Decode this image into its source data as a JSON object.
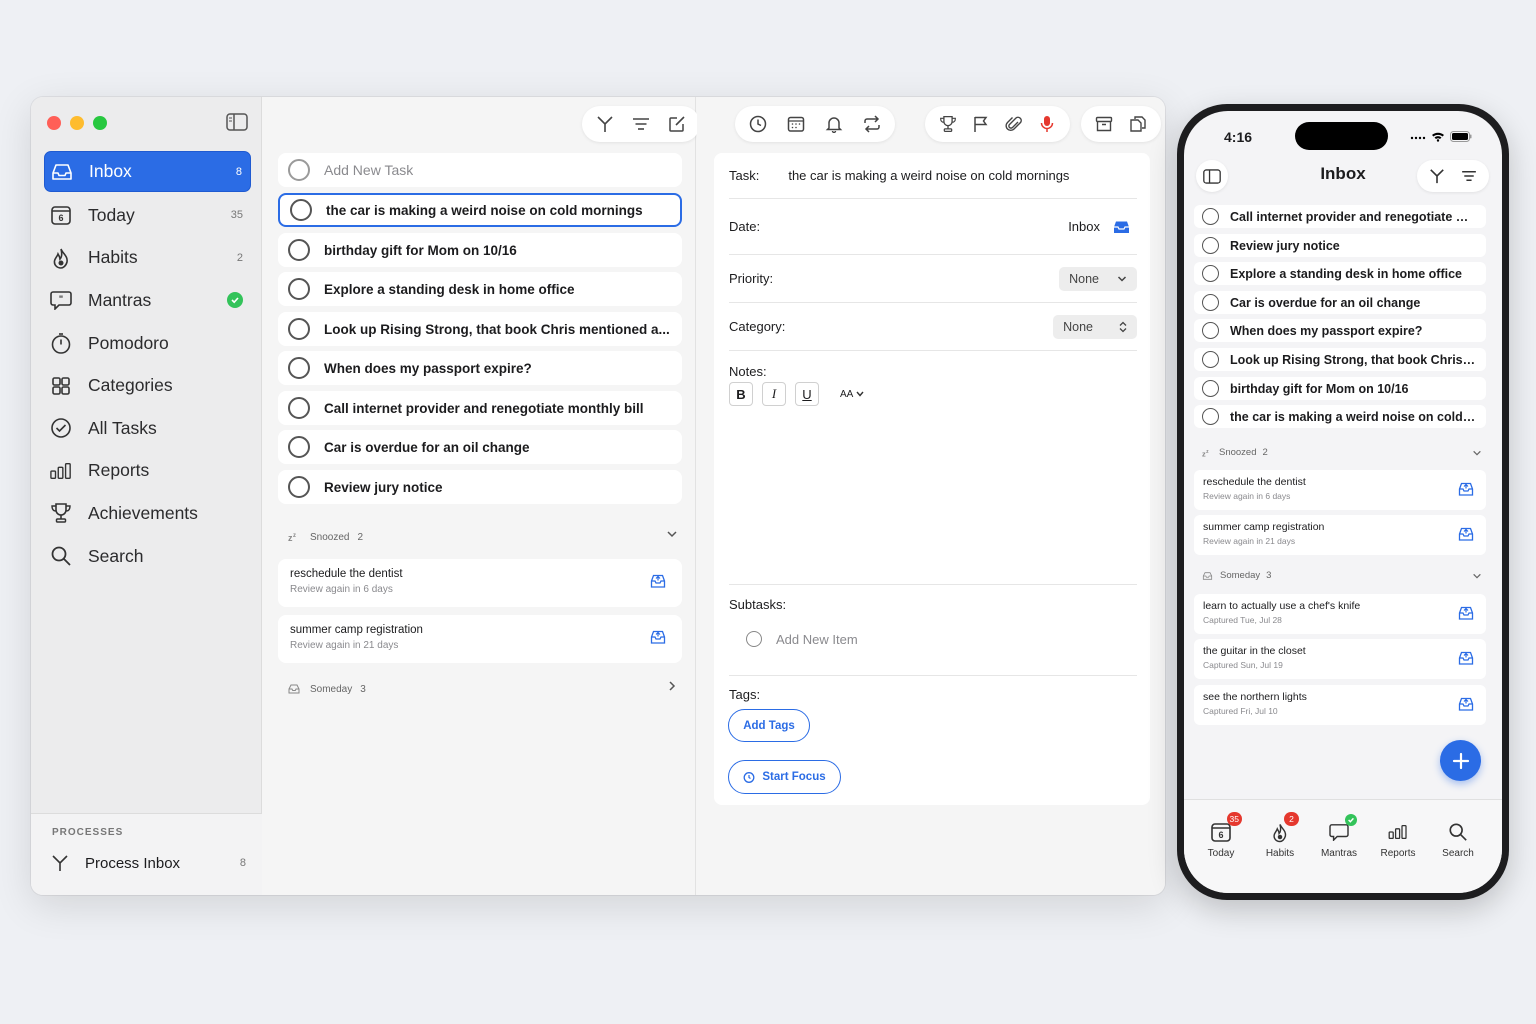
{
  "mac": {
    "sidebar": {
      "items": [
        {
          "label": "Inbox",
          "count": "8",
          "icon": "inbox-icon",
          "active": true
        },
        {
          "label": "Today",
          "count": "35",
          "icon": "calendar-icon"
        },
        {
          "label": "Habits",
          "count": "2",
          "icon": "flame-icon"
        },
        {
          "label": "Mantras",
          "count": "",
          "icon": "speech-bubble-icon"
        },
        {
          "label": "Pomodoro",
          "count": "",
          "icon": "timer-icon"
        },
        {
          "label": "Categories",
          "count": "",
          "icon": "grid-icon"
        },
        {
          "label": "All Tasks",
          "count": "",
          "icon": "check-circle-icon"
        },
        {
          "label": "Reports",
          "count": "",
          "icon": "bar-chart-icon"
        },
        {
          "label": "Achievements",
          "count": "",
          "icon": "trophy-icon"
        },
        {
          "label": "Search",
          "count": "",
          "icon": "search-icon"
        }
      ],
      "today_day": "6",
      "processes_header": "PROCESSES",
      "process_inbox": {
        "label": "Process Inbox",
        "count": "8"
      }
    },
    "list": {
      "add_placeholder": "Add New Task",
      "tasks": [
        "the car is making a weird noise on cold mornings",
        "birthday gift for Mom on 10/16",
        "Explore a standing desk in home office",
        "Look up Rising Strong, that book Chris mentioned a...",
        "When does my passport expire?",
        "Call internet provider and renegotiate monthly bill",
        "Car is overdue for an oil change",
        "Review jury notice"
      ],
      "snoozed": {
        "label": "Snoozed",
        "count": "2"
      },
      "snoozed_items": [
        {
          "title": "reschedule the dentist",
          "sub": "Review again in 6 days"
        },
        {
          "title": "summer camp registration",
          "sub": "Review again in 21 days"
        }
      ],
      "someday": {
        "label": "Someday",
        "count": "3"
      }
    },
    "detail": {
      "task_label": "Task:",
      "task_value": "the car is making a weird noise on cold mornings",
      "date_label": "Date:",
      "date_value": "Inbox",
      "priority_label": "Priority:",
      "priority_value": "None",
      "category_label": "Category:",
      "category_value": "None",
      "notes_label": "Notes:",
      "fmt_bold": "B",
      "fmt_italic": "I",
      "fmt_underline": "U",
      "fmt_size": "AA",
      "subtasks_label": "Subtasks:",
      "add_item_placeholder": "Add New Item",
      "tags_label": "Tags:",
      "add_tags": "Add Tags",
      "start_focus": "Start Focus"
    }
  },
  "phone": {
    "time": "4:16",
    "title": "Inbox",
    "tasks": [
      "Call internet provider and renegotiate m...",
      "Review jury notice",
      "Explore a standing desk in home office",
      "Car is overdue for an oil change",
      "When does my passport expire?",
      "Look up Rising Strong, that book Chris m...",
      "birthday gift for Mom on 10/16",
      "the car is making a weird noise on cold m..."
    ],
    "snoozed": {
      "label": "Snoozed",
      "count": "2"
    },
    "snoozed_items": [
      {
        "title": "reschedule the dentist",
        "sub": "Review again in 6 days"
      },
      {
        "title": "summer camp registration",
        "sub": "Review again in 21 days"
      }
    ],
    "someday": {
      "label": "Someday",
      "count": "3"
    },
    "someday_items": [
      {
        "title": "learn to actually use a chef's knife",
        "sub": "Captured Tue, Jul 28"
      },
      {
        "title": "the guitar in the closet",
        "sub": "Captured Sun, Jul 19"
      },
      {
        "title": "see the northern lights",
        "sub": "Captured Fri, Jul 10"
      }
    ],
    "tabs": [
      {
        "label": "Today",
        "badge": "35",
        "day": "6"
      },
      {
        "label": "Habits",
        "badge": "2"
      },
      {
        "label": "Mantras",
        "badge": ""
      },
      {
        "label": "Reports",
        "badge": ""
      },
      {
        "label": "Search",
        "badge": ""
      }
    ]
  },
  "colors": {
    "accent": "#2b6ce5",
    "red": "#e5382e",
    "green": "#33c35a"
  }
}
